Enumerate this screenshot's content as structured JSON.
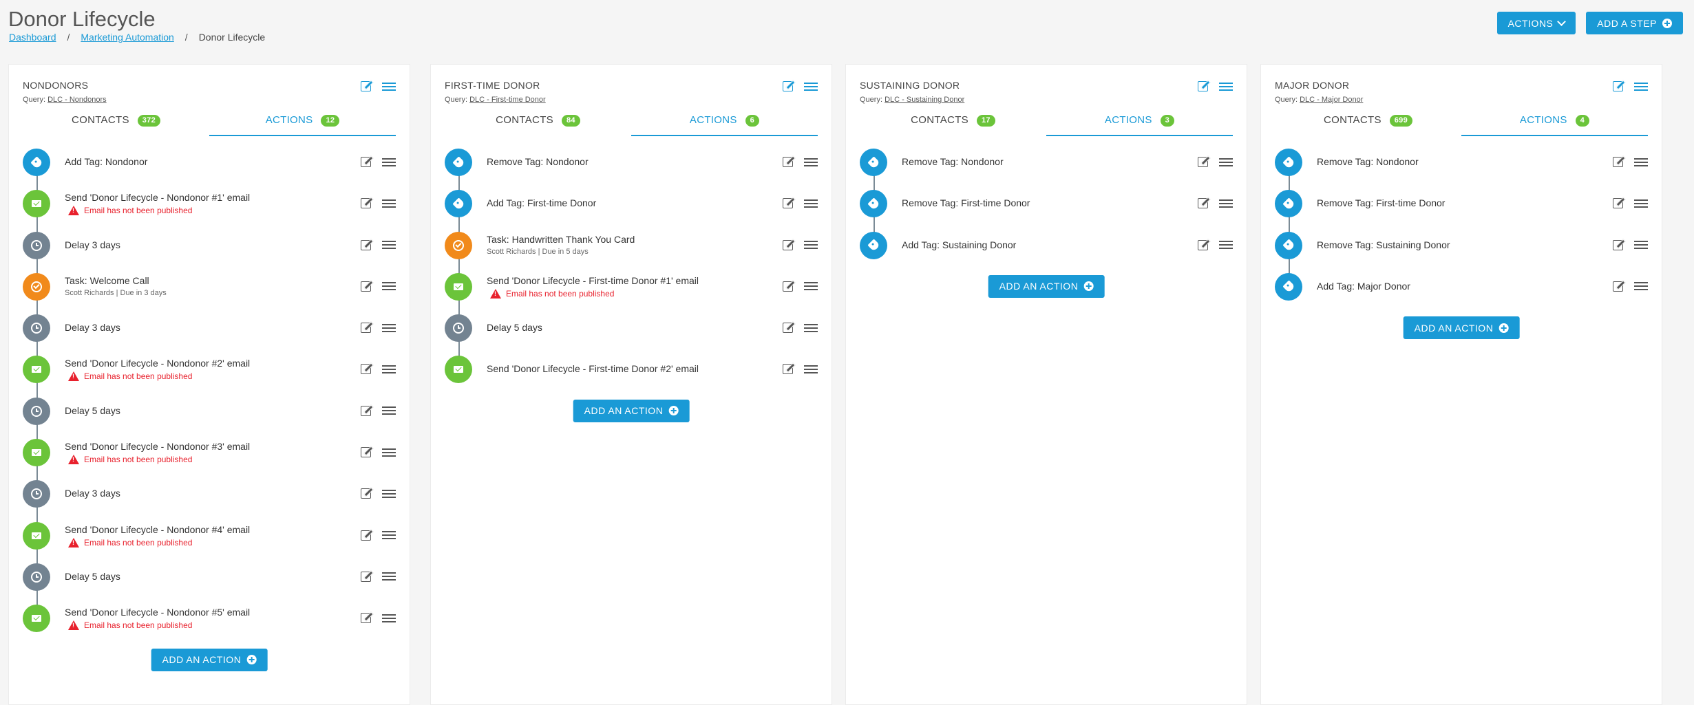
{
  "page": {
    "title": "Donor Lifecycle",
    "breadcrumb": [
      "Dashboard",
      "Marketing Automation",
      "Donor Lifecycle"
    ]
  },
  "header_buttons": {
    "actions_label": "ACTIONS",
    "add_step_label": "ADD A STEP"
  },
  "labels": {
    "query_prefix": "Query:",
    "contacts_tab": "CONTACTS",
    "actions_tab": "ACTIONS",
    "add_action": "ADD AN ACTION",
    "warning": "Email has not been published"
  },
  "columns": [
    {
      "title": "NONDONORS",
      "query": "DLC - Nondonors",
      "contacts_count": "372",
      "actions_count": "12",
      "actions": [
        {
          "type": "tag",
          "text": "Add Tag: Nondonor"
        },
        {
          "type": "email",
          "text": "Send 'Donor Lifecycle - Nondonor #1' email",
          "warning": true
        },
        {
          "type": "delay",
          "text": "Delay 3 days"
        },
        {
          "type": "task",
          "text": "Task: Welcome Call",
          "sub": "Scott Richards | Due in 3 days"
        },
        {
          "type": "delay",
          "text": "Delay 3 days"
        },
        {
          "type": "email",
          "text": "Send 'Donor Lifecycle - Nondonor #2' email",
          "warning": true
        },
        {
          "type": "delay",
          "text": "Delay 5 days"
        },
        {
          "type": "email",
          "text": "Send 'Donor Lifecycle - Nondonor #3' email",
          "warning": true
        },
        {
          "type": "delay",
          "text": "Delay 3 days"
        },
        {
          "type": "email",
          "text": "Send 'Donor Lifecycle - Nondonor #4' email",
          "warning": true
        },
        {
          "type": "delay",
          "text": "Delay 5 days"
        },
        {
          "type": "email",
          "text": "Send 'Donor Lifecycle - Nondonor #5' email",
          "warning": true
        }
      ]
    },
    {
      "title": "FIRST-TIME DONOR",
      "query": "DLC - First-time Donor",
      "contacts_count": "84",
      "actions_count": "6",
      "actions": [
        {
          "type": "tag",
          "text": "Remove Tag: Nondonor"
        },
        {
          "type": "tag",
          "text": "Add Tag: First-time Donor"
        },
        {
          "type": "task",
          "text": "Task: Handwritten Thank You Card",
          "sub": "Scott Richards | Due in 5 days"
        },
        {
          "type": "email",
          "text": "Send 'Donor Lifecycle - First-time Donor #1' email",
          "warning": true
        },
        {
          "type": "delay",
          "text": "Delay 5 days"
        },
        {
          "type": "email",
          "text": "Send 'Donor Lifecycle - First-time Donor #2' email"
        }
      ]
    },
    {
      "title": "SUSTAINING DONOR",
      "query": "DLC - Sustaining Donor",
      "contacts_count": "17",
      "actions_count": "3",
      "actions": [
        {
          "type": "tag",
          "text": "Remove Tag: Nondonor"
        },
        {
          "type": "tag",
          "text": "Remove Tag: First-time Donor"
        },
        {
          "type": "tag",
          "text": "Add Tag: Sustaining Donor"
        }
      ]
    },
    {
      "title": "MAJOR DONOR",
      "query": "DLC - Major Donor",
      "contacts_count": "699",
      "actions_count": "4",
      "actions": [
        {
          "type": "tag",
          "text": "Remove Tag: Nondonor"
        },
        {
          "type": "tag",
          "text": "Remove Tag: First-time Donor"
        },
        {
          "type": "tag",
          "text": "Remove Tag: Sustaining Donor"
        },
        {
          "type": "tag",
          "text": "Add Tag: Major Donor"
        }
      ]
    }
  ]
}
